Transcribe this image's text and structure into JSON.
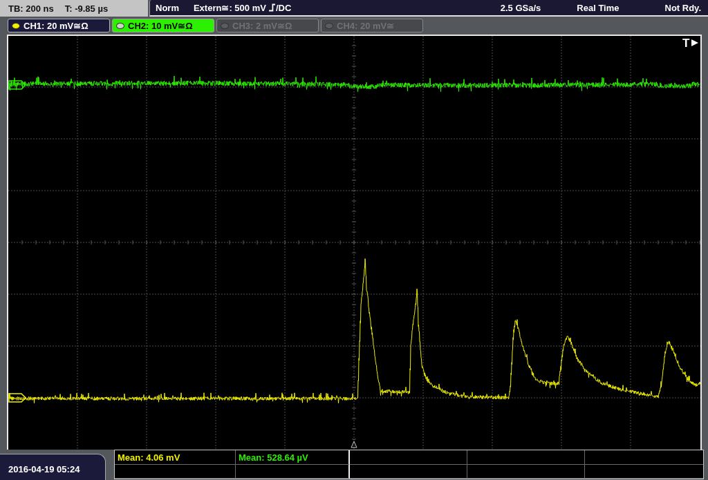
{
  "header": {
    "timebase": "TB: 200 ns",
    "trigger_time": "T: -9.85 µs",
    "trigger_mode": "Norm",
    "trigger_source": "Extern≅: 500 mV",
    "coupling": "/DC",
    "sample_rate": "2.5 GSa/s",
    "acquisition": "Real Time",
    "status": "Not Rdy."
  },
  "channels": [
    {
      "label": "CH1: 20 mV≅Ω",
      "on": true,
      "selected": false,
      "color": "#f0f000"
    },
    {
      "label": "CH2: 10 mV≅Ω",
      "on": true,
      "selected": true,
      "color": "#2cf000"
    },
    {
      "label": "CH3: 2 mV≅Ω",
      "on": false,
      "selected": false
    },
    {
      "label": "CH4: 20 mV≅",
      "on": false,
      "selected": false
    }
  ],
  "display": {
    "trigger_marker": "T"
  },
  "measurements": [
    {
      "text": "Mean: 4.06 mV",
      "color": "#f0f000"
    },
    {
      "text": "Mean: 528.64 µV",
      "color": "#2cf000"
    }
  ],
  "datetime": "2016-04-19 05:24"
}
